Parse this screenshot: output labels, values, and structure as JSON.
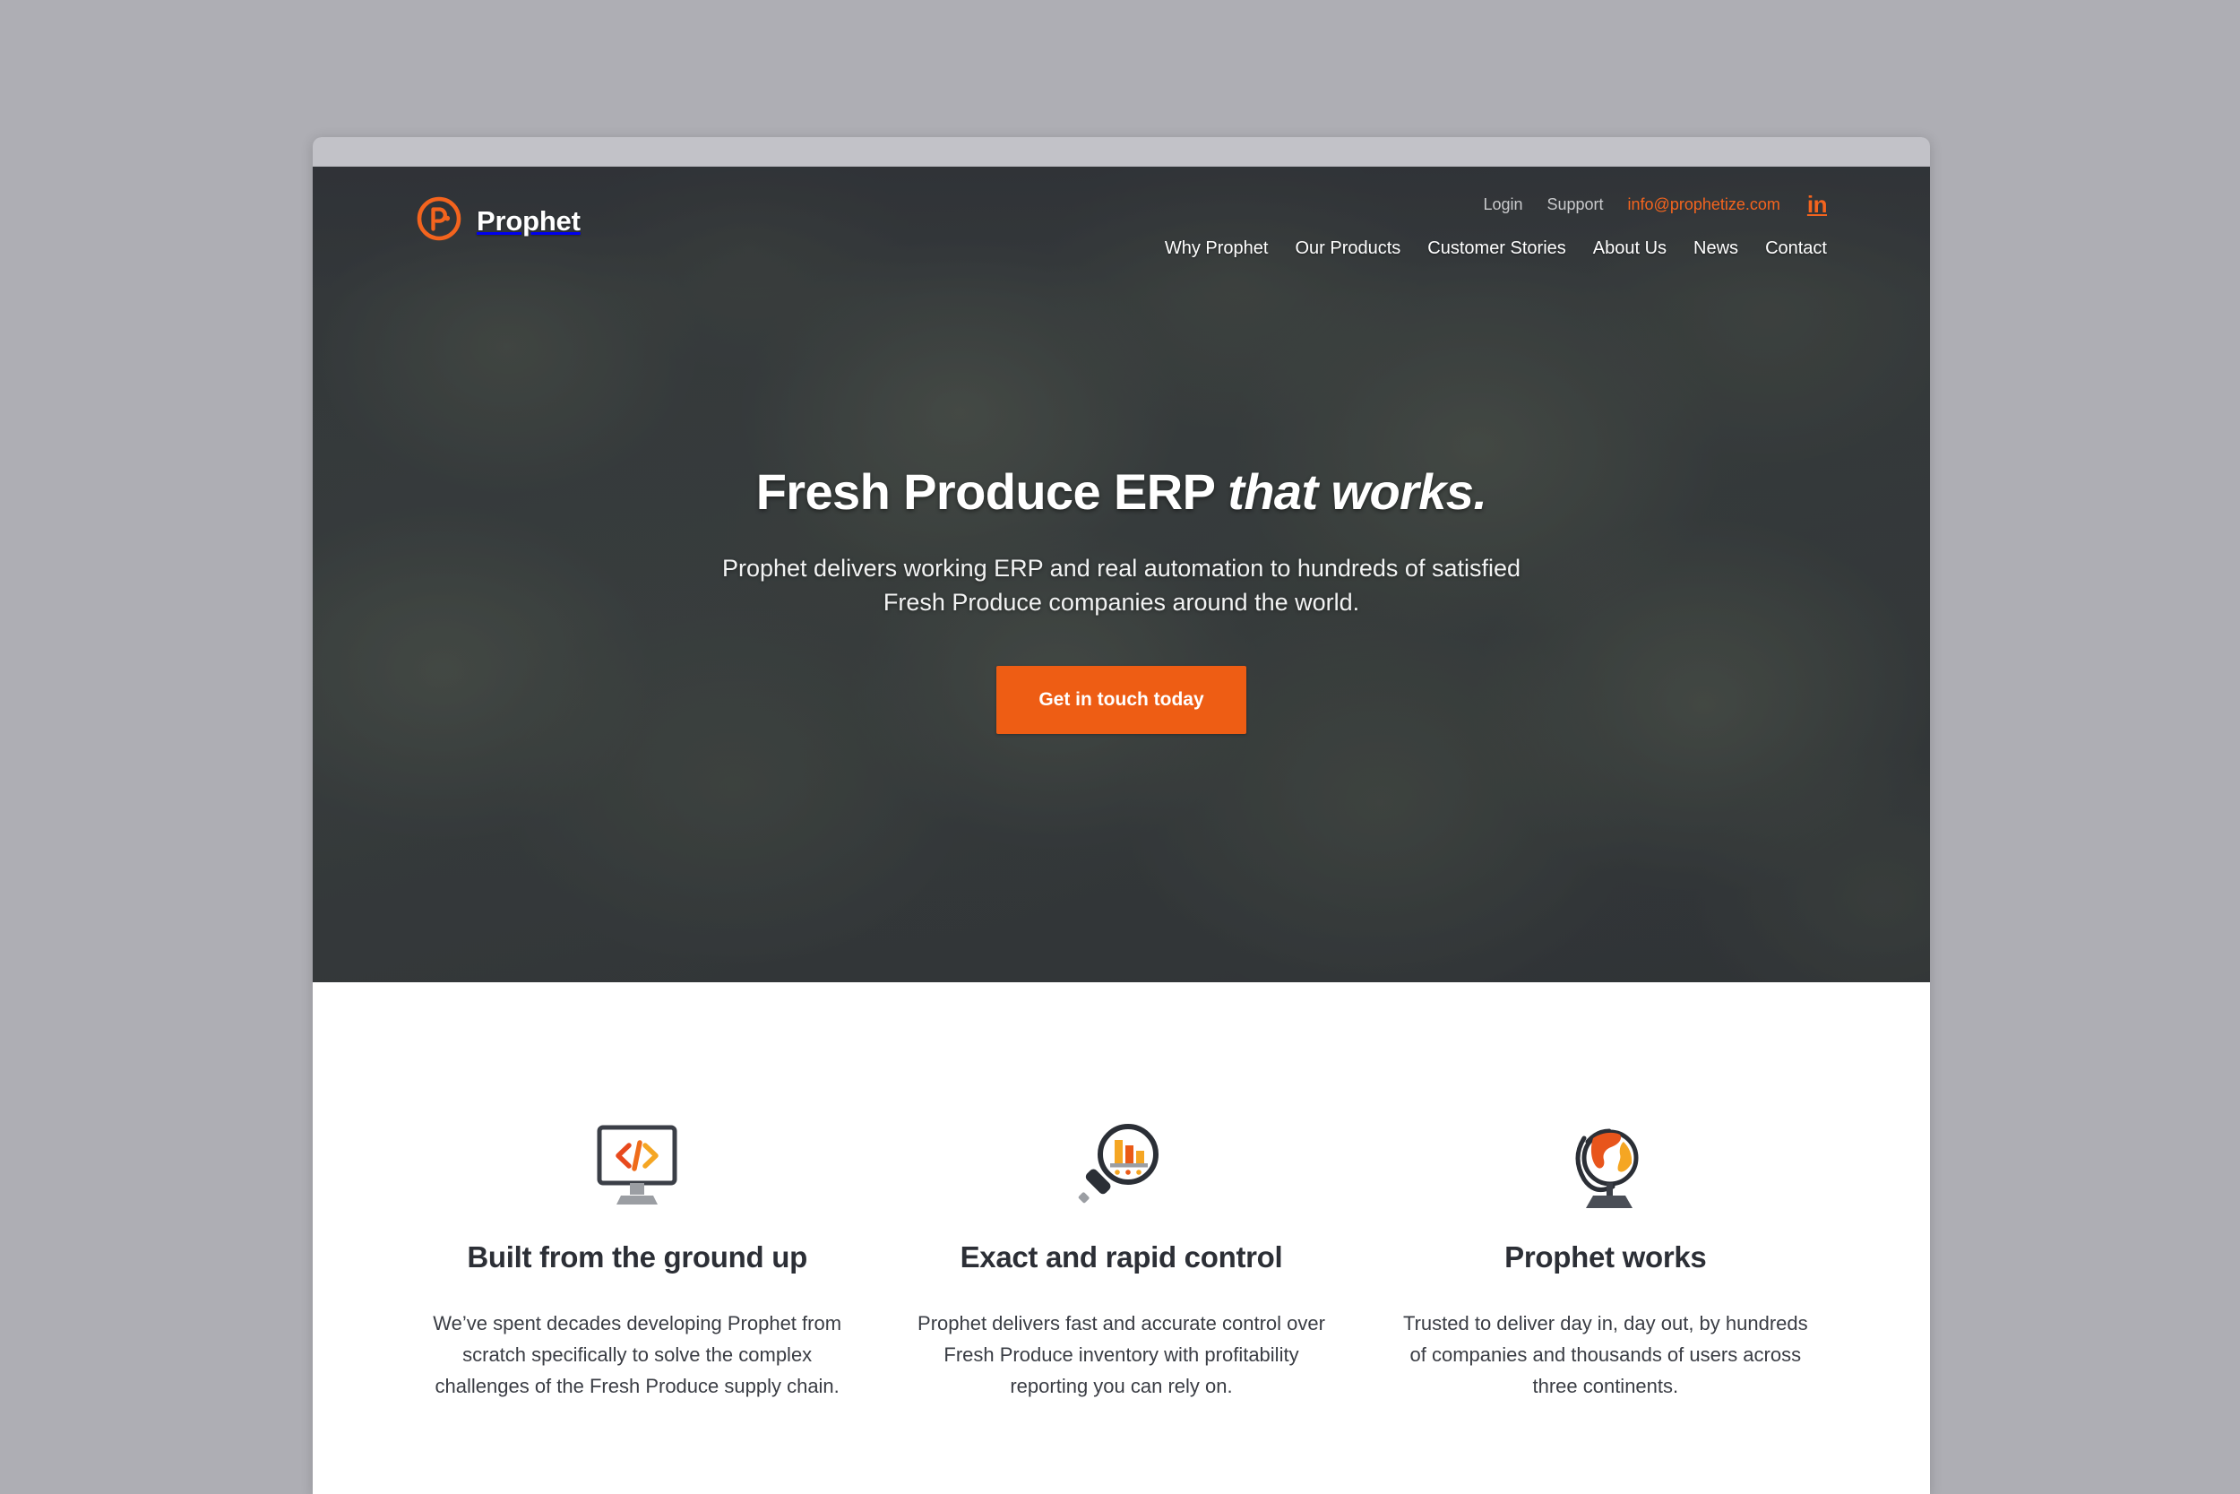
{
  "brand": {
    "name": "Prophet",
    "logo_icon": "prophet-pin-logo-icon",
    "accent_color": "#ee5d14"
  },
  "header": {
    "utility_links": [
      {
        "label": "Login",
        "name": "login"
      },
      {
        "label": "Support",
        "name": "support"
      }
    ],
    "email": "info@prophetize.com",
    "social": {
      "icon": "linkedin-icon",
      "label": "in"
    },
    "nav_items": [
      {
        "label": "Why Prophet",
        "name": "why-prophet"
      },
      {
        "label": "Our Products",
        "name": "our-products"
      },
      {
        "label": "Customer Stories",
        "name": "customer-stories"
      },
      {
        "label": "About Us",
        "name": "about-us"
      },
      {
        "label": "News",
        "name": "news"
      },
      {
        "label": "Contact",
        "name": "contact"
      }
    ]
  },
  "hero": {
    "title_main": "Fresh Produce ERP",
    "title_em": "that works.",
    "subtitle": "Prophet delivers working ERP and real automation to hundreds of satisfied Fresh Produce companies around the world.",
    "cta_label": "Get in touch today",
    "background_image": "fresh-lettuce-leaves-photo"
  },
  "features": [
    {
      "icon": "monitor-code-icon",
      "title": "Built from the ground up",
      "text": "We’ve spent decades developing Prophet from scratch specifically to solve the complex challenges of the Fresh Produce supply chain."
    },
    {
      "icon": "magnifier-bar-chart-icon",
      "title": "Exact and rapid control",
      "text": "Prophet delivers fast and accurate control over Fresh Produce inventory with profitability reporting you can rely on."
    },
    {
      "icon": "desk-globe-icon",
      "title": "Prophet works",
      "text": "Trusted to deliver day in, day out, by hundreds of companies and thousands of users across three continents."
    }
  ]
}
